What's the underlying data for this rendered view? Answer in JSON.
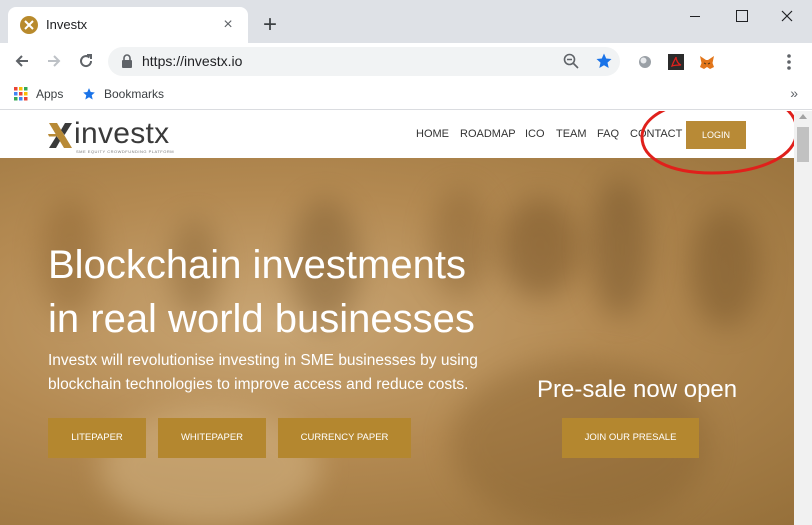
{
  "browser": {
    "tab_title": "Investx",
    "url": "https://investx.io",
    "bookmarks": [
      {
        "label": "Apps",
        "icon": "apps-grid-icon"
      },
      {
        "label": "Bookmarks",
        "icon": "star-icon"
      }
    ],
    "bookmarks_more": "»",
    "new_tab": "+",
    "tab_close": "×"
  },
  "site": {
    "logo_text": "investx",
    "logo_tagline": "SME EQUITY CROWDFUNDING PLATFORM",
    "nav": [
      "HOME",
      "ROADMAP",
      "ICO",
      "TEAM",
      "FAQ",
      "CONTACT"
    ],
    "login": "LOGIN",
    "hero": {
      "title_line1": "Blockchain investments",
      "title_line2": "in real world businesses",
      "subtitle_line1": "Investx will revolutionise investing in SME businesses by using",
      "subtitle_line2": "blockchain technologies to improve access and reduce costs.",
      "buttons": [
        "LITEPAPER",
        "WHITEPAPER",
        "CURRENCY PAPER"
      ],
      "presale_heading": "Pre-sale now open",
      "presale_button": "JOIN OUR PRESALE"
    }
  },
  "colors": {
    "brand_gold": "#b4872f",
    "annotation_red": "#e0201b"
  }
}
